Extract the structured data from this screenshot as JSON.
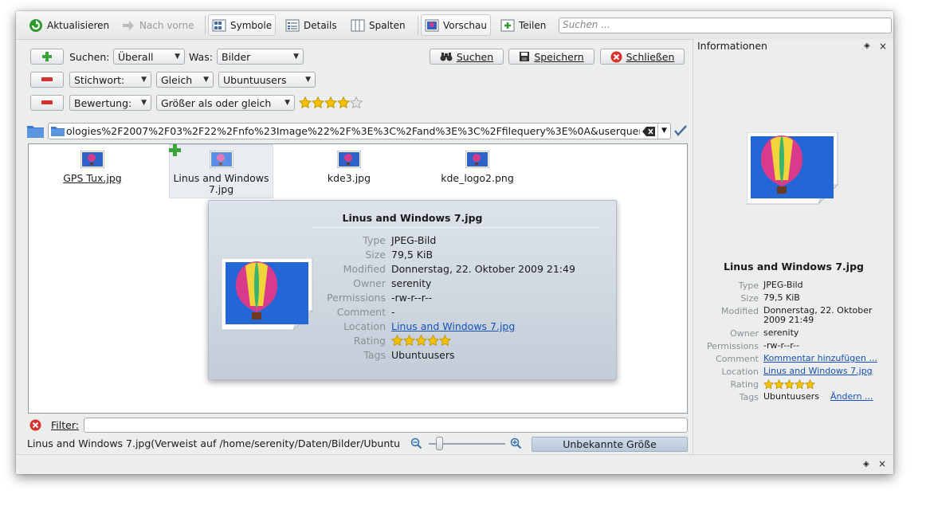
{
  "toolbar": {
    "reload": "Aktualisieren",
    "forward": "Nach vorne",
    "icons": "Symbole",
    "details": "Details",
    "columns": "Spalten",
    "preview": "Vorschau",
    "share": "Teilen",
    "search_placeholder": "Suchen ..."
  },
  "query": {
    "search_label": "Suchen:",
    "scope": "Überall",
    "what_label": "Was:",
    "what": "Bilder",
    "search_btn": "Suchen",
    "save_btn": "Speichern",
    "close_btn": "Schließen",
    "row2_field": "Stichwort:",
    "row2_op": "Gleich",
    "row2_value": "Ubuntuusers",
    "row3_field": "Bewertung:",
    "row3_op": "Größer als oder gleich",
    "row3_rating": 4
  },
  "location_url": "ologies%2F2007%2F03%2F22%2Fnfo%23Image%22%2F%3E%3C%2Fand%3E%3C%2Ffilequery%3E%0A&userquery=",
  "files": [
    {
      "name": "GPS Tux.jpg"
    },
    {
      "name": "Linus and Windows 7.jpg",
      "line1": "Linus and Windows",
      "line2": "7.jpg"
    },
    {
      "name": "kde3.jpg"
    },
    {
      "name": "kde_logo2.png"
    }
  ],
  "tooltip": {
    "title": "Linus and Windows 7.jpg",
    "rows": [
      {
        "key": "Type",
        "value": "JPEG-Bild"
      },
      {
        "key": "Size",
        "value": "79,5 KiB"
      },
      {
        "key": "Modified",
        "value": "Donnerstag, 22. Oktober 2009 21:49"
      },
      {
        "key": "Owner",
        "value": "serenity"
      },
      {
        "key": "Permissions",
        "value": "-rw-r--r--"
      },
      {
        "key": "Comment",
        "value": "-"
      },
      {
        "key": "Location",
        "value": "Linus and Windows 7.jpg"
      },
      {
        "key": "Rating",
        "value": ""
      },
      {
        "key": "Tags",
        "value": "Ubuntuusers"
      }
    ],
    "rating": 5
  },
  "filter_label": "Filter:",
  "status_text": "Linus and Windows 7.jpg(Verweist auf /home/serenity/Daten/Bilder/Ubuntu",
  "size_label": "Unbekannte Größe",
  "info_panel": {
    "title": "Informationen",
    "file_title": "Linus and Windows 7.jpg",
    "rows": [
      {
        "key": "Type",
        "value": "JPEG-Bild"
      },
      {
        "key": "Size",
        "value": "79,5 KiB"
      },
      {
        "key": "Modified",
        "value": "Donnerstag, 22. Oktober 2009 21:49"
      },
      {
        "key": "Owner",
        "value": "serenity"
      },
      {
        "key": "Permissions",
        "value": "-rw-r--r--"
      },
      {
        "key": "Comment",
        "value": "Kommentar hinzufügen ..."
      },
      {
        "key": "Location",
        "value": "Linus and Windows 7.jpg"
      },
      {
        "key": "Rating",
        "value": ""
      },
      {
        "key": "Tags",
        "value": "Ubuntuusers",
        "action": "Ändern ..."
      }
    ],
    "rating": 5
  },
  "colors": {
    "link": "#1651b5",
    "star": "#f2c200",
    "accent": "#2d6ed0"
  }
}
